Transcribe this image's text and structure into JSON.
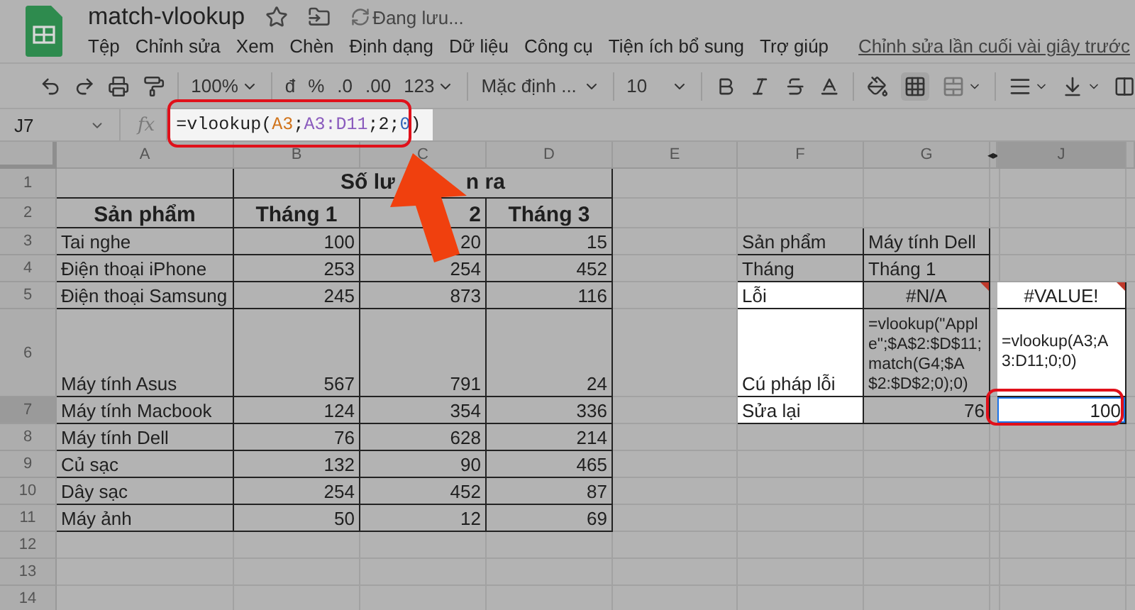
{
  "document": {
    "title": "match-vlookup",
    "save_status": "Đang lưu..."
  },
  "menu": {
    "items": [
      "Tệp",
      "Chỉnh sửa",
      "Xem",
      "Chèn",
      "Định dạng",
      "Dữ liệu",
      "Công cụ",
      "Tiện ích bổ sung",
      "Trợ giúp"
    ],
    "last_edit": "Chỉnh sửa lần cuối vài giây trước"
  },
  "toolbar": {
    "zoom": "100%",
    "format_buttons": [
      "đ",
      "%",
      ".0",
      ".00"
    ],
    "more_formats": "123",
    "font": "Mặc định ...",
    "font_size": "10"
  },
  "formula_bar": {
    "cell_ref": "J7",
    "fx_label": "fx",
    "formula": [
      {
        "text": "=vlookup(",
        "kind": "plain"
      },
      {
        "text": "A3",
        "kind": "ref1"
      },
      {
        "text": ";",
        "kind": "plain"
      },
      {
        "text": "A3:D11",
        "kind": "ref2"
      },
      {
        "text": ";2;",
        "kind": "plain"
      },
      {
        "text": "0",
        "kind": "number"
      },
      {
        "text": ")",
        "kind": "plain"
      }
    ]
  },
  "columns": [
    {
      "label": "A",
      "selected": false
    },
    {
      "label": "B",
      "selected": false
    },
    {
      "label": "C",
      "selected": false
    },
    {
      "label": "D",
      "selected": false
    },
    {
      "label": "E",
      "selected": false
    },
    {
      "label": "F",
      "selected": false
    },
    {
      "label": "G",
      "selected": false
    },
    {
      "kind": "hidden",
      "marker": "◂▸"
    },
    {
      "label": "J",
      "selected": true
    }
  ],
  "rows": [
    {
      "number": "1",
      "selected": false,
      "cells": [
        {
          "kind": "blank"
        },
        {
          "kind": "merged",
          "parts": [
            "Số lư",
            "n ra"
          ]
        },
        {},
        {},
        {},
        {},
        {}
      ]
    },
    {
      "number": "2",
      "selected": false,
      "cells": [
        {
          "text": "Sản phẩm",
          "kind": "header"
        },
        {
          "text": "Tháng 1",
          "kind": "header"
        },
        {
          "text": "2",
          "kind": "header_right"
        },
        {
          "text": "Tháng 3",
          "kind": "header"
        },
        {},
        {},
        {},
        {},
        {}
      ]
    },
    {
      "number": "3",
      "selected": false,
      "cells": [
        {
          "text": "Tai nghe",
          "kind": "text"
        },
        {
          "text": "100",
          "kind": "number"
        },
        {
          "text": "20",
          "kind": "number"
        },
        {
          "text": "15",
          "kind": "number"
        },
        {},
        {
          "text": "Sản phẩm",
          "kind": "text"
        },
        {
          "text": "Máy tính Dell",
          "kind": "text"
        },
        {},
        {}
      ]
    },
    {
      "number": "4",
      "selected": false,
      "cells": [
        {
          "text": "Điện thoại iPhone",
          "kind": "text"
        },
        {
          "text": "253",
          "kind": "number"
        },
        {
          "text": "254",
          "kind": "number"
        },
        {
          "text": "452",
          "kind": "number"
        },
        {},
        {
          "text": "Tháng",
          "kind": "text"
        },
        {
          "text": "Tháng 1",
          "kind": "text"
        },
        {},
        {}
      ]
    },
    {
      "number": "5",
      "selected": false,
      "cells": [
        {
          "text": "Điện thoại Samsung",
          "kind": "text"
        },
        {
          "text": "245",
          "kind": "number"
        },
        {
          "text": "873",
          "kind": "number"
        },
        {
          "text": "116",
          "kind": "number"
        },
        {},
        {
          "text": "Lỗi",
          "kind": "text",
          "highlighted": true
        },
        {
          "text": "#N/A",
          "kind": "error",
          "highlighted": false
        },
        {},
        {
          "text": "#VALUE!",
          "kind": "error",
          "highlighted": true
        }
      ]
    },
    {
      "number": "6",
      "selected": false,
      "cells": [
        {
          "text": "Máy tính Asus",
          "kind": "text"
        },
        {
          "text": "567",
          "kind": "number"
        },
        {
          "text": "791",
          "kind": "number"
        },
        {
          "text": "24",
          "kind": "number"
        },
        {},
        {
          "text": "Cú pháp lỗi",
          "kind": "text",
          "highlighted": true
        },
        {
          "text": "=vlookup(\"Apple\";$A$2:$D$11;match(G4;$A$2:$D$2;0);0)",
          "kind": "formula",
          "highlighted": false
        },
        {},
        {
          "text": "=vlookup(A3;A3:D11;0;0)",
          "kind": "formula_middle",
          "highlighted": true
        }
      ]
    },
    {
      "number": "7",
      "selected": true,
      "cells": [
        {
          "text": "Máy tính Macbook",
          "kind": "text"
        },
        {
          "text": "124",
          "kind": "number"
        },
        {
          "text": "354",
          "kind": "number"
        },
        {
          "text": "336",
          "kind": "number"
        },
        {},
        {
          "text": "Sửa lại",
          "kind": "text",
          "highlighted": true
        },
        {
          "text": "76",
          "kind": "number",
          "highlighted": false
        },
        {},
        {
          "text": "100",
          "kind": "number",
          "highlighted": true,
          "selected": true
        }
      ]
    },
    {
      "number": "8",
      "selected": false,
      "cells": [
        {
          "text": "Máy tính Dell",
          "kind": "text"
        },
        {
          "text": "76",
          "kind": "number"
        },
        {
          "text": "628",
          "kind": "number"
        },
        {
          "text": "214",
          "kind": "number"
        },
        {},
        {},
        {},
        {},
        {}
      ]
    },
    {
      "number": "9",
      "selected": false,
      "cells": [
        {
          "text": "Củ sạc",
          "kind": "text"
        },
        {
          "text": "132",
          "kind": "number"
        },
        {
          "text": "90",
          "kind": "number"
        },
        {
          "text": "465",
          "kind": "number"
        },
        {},
        {},
        {},
        {},
        {}
      ]
    },
    {
      "number": "10",
      "selected": false,
      "cells": [
        {
          "text": "Dây sạc",
          "kind": "text"
        },
        {
          "text": "254",
          "kind": "number"
        },
        {
          "text": "452",
          "kind": "number"
        },
        {
          "text": "87",
          "kind": "number"
        },
        {},
        {},
        {},
        {},
        {}
      ]
    },
    {
      "number": "11",
      "selected": false,
      "cells": [
        {
          "text": "Máy ảnh",
          "kind": "text"
        },
        {
          "text": "50",
          "kind": "number"
        },
        {
          "text": "12",
          "kind": "number"
        },
        {
          "text": "69",
          "kind": "number"
        },
        {},
        {},
        {},
        {},
        {}
      ]
    },
    {
      "number": "12",
      "selected": false,
      "cells": [
        {},
        {},
        {},
        {},
        {},
        {},
        {},
        {},
        {}
      ]
    },
    {
      "number": "13",
      "selected": false,
      "cells": [
        {},
        {},
        {},
        {},
        {},
        {},
        {},
        {},
        {}
      ]
    },
    {
      "number": "14",
      "selected": false,
      "cells": [
        {},
        {},
        {},
        {},
        {},
        {},
        {},
        {},
        {}
      ]
    }
  ]
}
